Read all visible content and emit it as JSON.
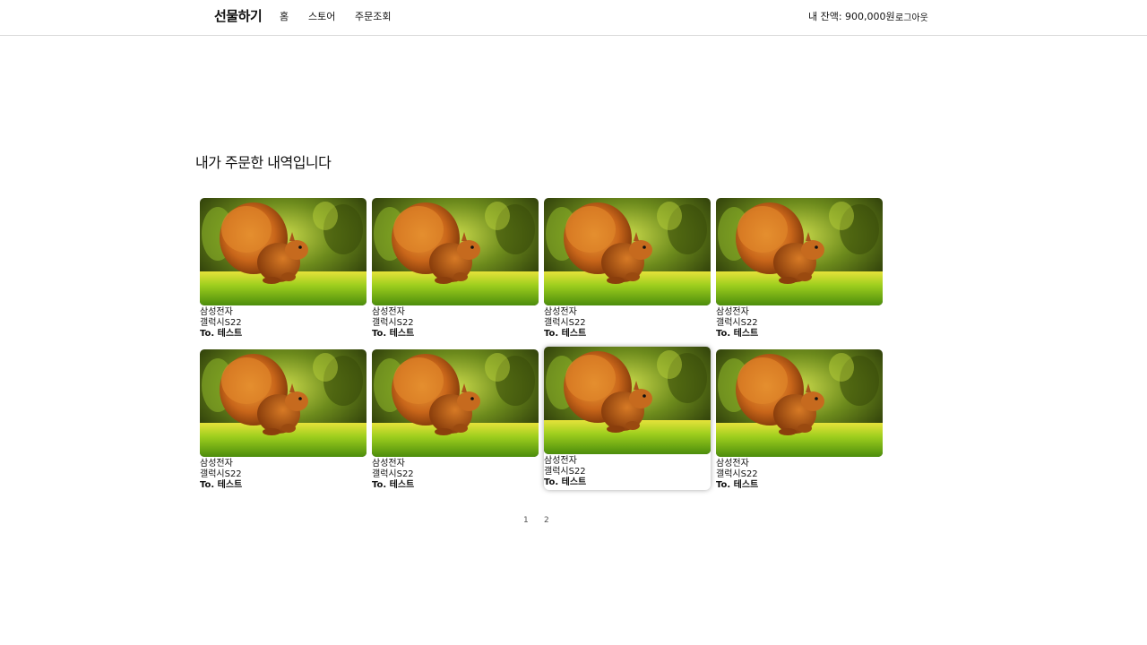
{
  "header": {
    "brand": "선물하기",
    "nav": [
      {
        "label": "홈"
      },
      {
        "label": "스토어"
      },
      {
        "label": "주문조회"
      }
    ],
    "balance": "내 잔액: 900,000원",
    "logout": "로그아웃"
  },
  "page_title": "내가 주문한 내역입니다",
  "orders": [
    {
      "brand": "삼성전자",
      "product": "갤럭시S22",
      "recipient": "To. 테스트",
      "image": "squirrel-photo"
    },
    {
      "brand": "삼성전자",
      "product": "갤럭시S22",
      "recipient": "To. 테스트",
      "image": "squirrel-photo"
    },
    {
      "brand": "삼성전자",
      "product": "갤럭시S22",
      "recipient": "To. 테스트",
      "image": "squirrel-photo"
    },
    {
      "brand": "삼성전자",
      "product": "갤럭시S22",
      "recipient": "To. 테스트",
      "image": "squirrel-photo"
    },
    {
      "brand": "삼성전자",
      "product": "갤럭시S22",
      "recipient": "To. 테스트",
      "image": "squirrel-photo"
    },
    {
      "brand": "삼성전자",
      "product": "갤럭시S22",
      "recipient": "To. 테스트",
      "image": "squirrel-photo"
    },
    {
      "brand": "삼성전자",
      "product": "갤럭시S22",
      "recipient": "To. 테스트",
      "image": "squirrel-photo"
    },
    {
      "brand": "삼성전자",
      "product": "갤럭시S22",
      "recipient": "To. 테스트",
      "image": "squirrel-photo"
    }
  ],
  "pagination": {
    "pages": [
      "1",
      "2"
    ]
  }
}
